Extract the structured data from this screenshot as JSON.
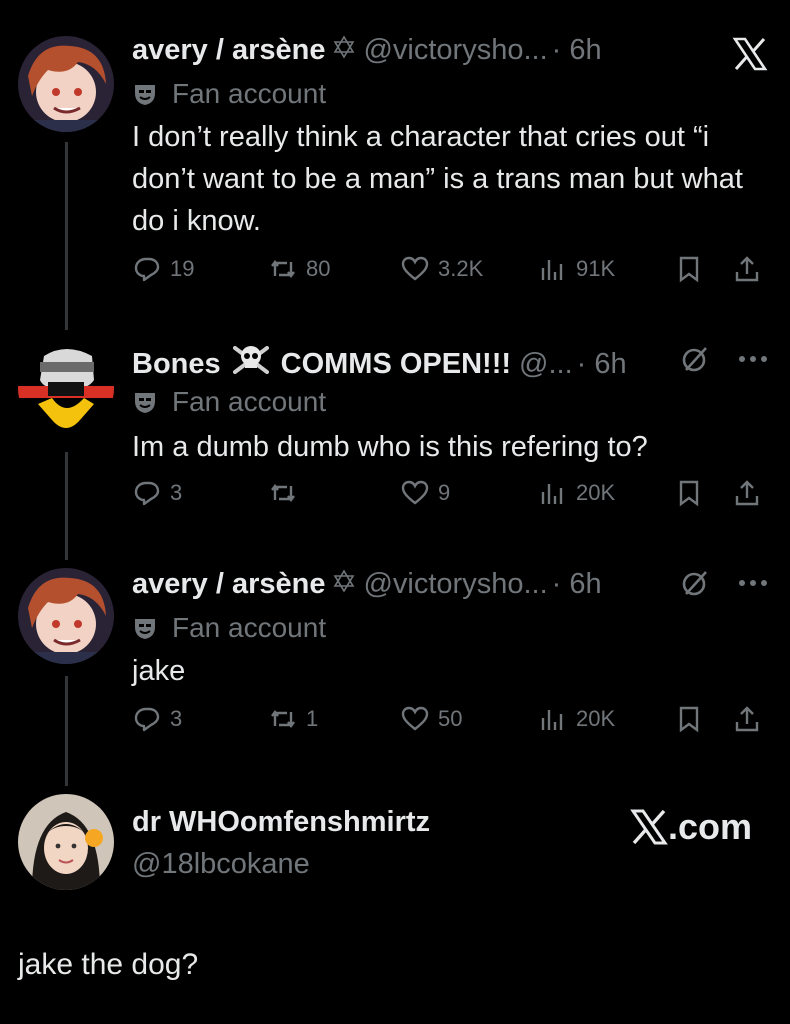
{
  "thread": [
    {
      "name": "avery / arsène",
      "handle": "@victorysho...",
      "time": "· 6h",
      "affiliation": "Fan account",
      "text": "I don’t really think a character that cries out “i don’t want to be a man” is a trans man but what do i know.",
      "replies": "19",
      "reposts": "80",
      "likes": "3.2K",
      "views": "91K"
    },
    {
      "name": "Bones",
      "name_suffix": "COMMS OPEN!!!",
      "handle": "@...",
      "time": "· 6h",
      "affiliation": "Fan account",
      "text": "Im a dumb dumb who is this refering to?",
      "replies": "3",
      "reposts": "",
      "likes": "9",
      "views": "20K"
    },
    {
      "name": "avery / arsène",
      "handle": "@victorysho...",
      "time": "· 6h",
      "affiliation": "Fan account",
      "text": "jake",
      "replies": "3",
      "reposts": "1",
      "likes": "50",
      "views": "20K"
    }
  ],
  "share_card": {
    "name": "dr WHOomfenshmirtz",
    "handle": "@18lbcokane",
    "brand": ".com",
    "reply_text": "jake the dog?"
  },
  "colors": {
    "background": "#000000",
    "text": "#e7e9ea",
    "secondary": "#71767b",
    "thread_line": "#333639"
  }
}
